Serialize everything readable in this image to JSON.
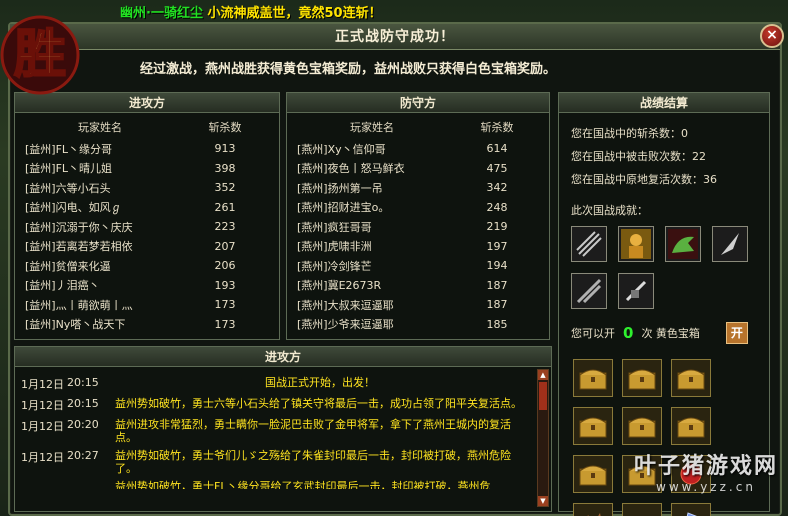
{
  "background": {
    "chat_text_a": "幽州·一骑红尘",
    "chat_text_b": "小流神威盖世，竟然50连斩！",
    "colors": {
      "chat": "#22e022",
      "chat_highlight": "#ffe400"
    }
  },
  "logo": {
    "text": "胜"
  },
  "dialog": {
    "title": "正式战防守成功！",
    "close_label": "×",
    "banner": "经过激战，燕州战胜获得黄色宝箱奖励，益州战败只获得白色宝箱奖励。"
  },
  "attack_panel": {
    "title": "进攻方",
    "col_name": "玩家姓名",
    "col_kills": "斩杀数",
    "rows": [
      {
        "name": "[益州]FL丶缘分哥",
        "kills": "913"
      },
      {
        "name": "[益州]FL丶晴儿姐",
        "kills": "398"
      },
      {
        "name": "[益州]六等小石头",
        "kills": "352"
      },
      {
        "name": "[益州]闪电、如风ℊ",
        "kills": "261"
      },
      {
        "name": "[益州]沉溺于你丶庆庆",
        "kills": "223"
      },
      {
        "name": "[益州]若离若梦若相依",
        "kills": "207"
      },
      {
        "name": "[益州]贫僧来化逼",
        "kills": "206"
      },
      {
        "name": "[益州]丿泪癌丶",
        "kills": "193"
      },
      {
        "name": "[益州]灬丨萌欲萌丨灬",
        "kills": "173"
      },
      {
        "name": "[益州]Ny嗒丶战天下",
        "kills": "173"
      }
    ]
  },
  "defense_panel": {
    "title": "防守方",
    "col_name": "玩家姓名",
    "col_kills": "斩杀数",
    "rows": [
      {
        "name": "[燕州]Xy丶信仰哥",
        "kills": "614"
      },
      {
        "name": "[燕州]夜色丨怒马鲜衣",
        "kills": "475"
      },
      {
        "name": "[燕州]扬州第一吊",
        "kills": "342"
      },
      {
        "name": "[燕州]招财进宝ο。",
        "kills": "248"
      },
      {
        "name": "[燕州]疯狂哥哥",
        "kills": "219"
      },
      {
        "name": "[燕州]虎啸非洲",
        "kills": "197"
      },
      {
        "name": "[燕州]冷剑锋芒",
        "kills": "194"
      },
      {
        "name": "[燕州]冀E2673R",
        "kills": "187"
      },
      {
        "name": "[燕州]大叔来逗逼耶",
        "kills": "187"
      },
      {
        "name": "[燕州]少爷来逗逼耶",
        "kills": "185"
      }
    ]
  },
  "summary_panel": {
    "title": "战绩结算",
    "kills_line": "您在国战中的斩杀数：0",
    "defeated_line": "您在国战中被击败次数：22",
    "revive_line": "您在国战中原地复活次数：36",
    "achievements_label": "此次国战成就：",
    "achievement_icons": [
      "claw-slash-icon",
      "warrior-portrait-icon",
      "green-dragon-icon",
      "silver-blade-icon",
      "twin-blade-icon",
      "armor-slash-icon"
    ],
    "open_prefix": "您可以开",
    "open_count": "0",
    "open_suffix": "次 黄色宝箱",
    "open_button": "开",
    "reward_icons": [
      "gold-chest-icon",
      "gold-chest-icon",
      "gold-chest-icon",
      "gold-chest-icon",
      "gold-chest-icon",
      "gold-chest-icon",
      "gold-chest-icon",
      "gold-chest-icon",
      "red-gem-icon",
      "dragon-statue-icon",
      "gold-ingot-icon",
      "blue-crystal-icon"
    ]
  },
  "log_panel": {
    "title": "进攻方",
    "entries": [
      {
        "date": "1月12日",
        "time": "20:15",
        "msg": "国战正式开始，出发！",
        "center": true
      },
      {
        "date": "1月12日",
        "time": "20:15",
        "msg": "益州势如破竹，勇士六等小石头给了镇关守将最后一击，成功占领了阳平关复活点。",
        "center": false
      },
      {
        "date": "1月12日",
        "time": "20:20",
        "msg": "益州进攻非常猛烈，勇士瞒你一脸泥巴击败了金甲将军，拿下了燕州王城内的复活点。",
        "center": false
      },
      {
        "date": "1月12日",
        "time": "20:27",
        "msg": "益州势如破竹，勇士爷们儿ゞ之殇给了朱雀封印最后一击，封印被打破，燕州危险了。",
        "center": false
      },
      {
        "date": "",
        "time": "",
        "msg": "益州势如破竹，勇士FL丶缘分哥给了玄武封印最后一击，封印被打破，燕州危",
        "center": false
      }
    ]
  },
  "watermark": {
    "main": "叶子猪游戏网",
    "url": "www.yzz.cn"
  },
  "colors": {
    "accent_green": "#2ef02e",
    "log_text": "#ffe420",
    "panel_border": "#5d6b55"
  }
}
